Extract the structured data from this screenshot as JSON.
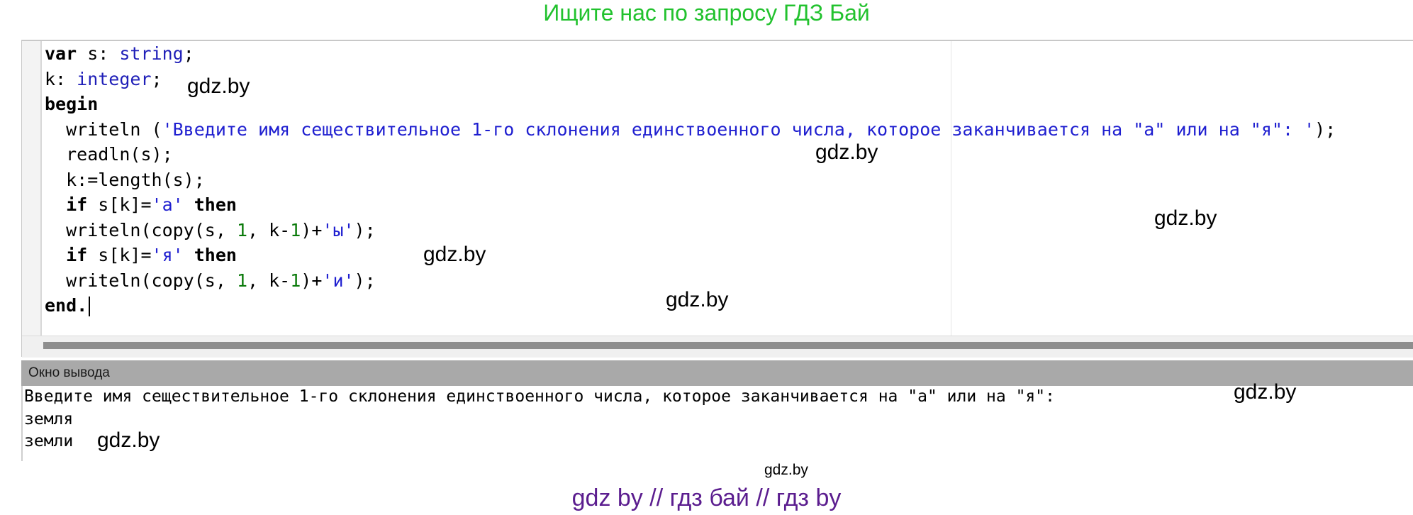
{
  "banner": {
    "top": "Ищите нас по запросу ГДЗ Бай",
    "bottom": "gdz by  //  гдз бай  //  гдз by"
  },
  "editor": {
    "lines": [
      [
        {
          "t": "var",
          "c": "kw"
        },
        {
          "t": " s: ",
          "c": ""
        },
        {
          "t": "string",
          "c": "ty"
        },
        {
          "t": ";",
          "c": ""
        }
      ],
      [
        {
          "t": "k: ",
          "c": ""
        },
        {
          "t": "integer",
          "c": "ty"
        },
        {
          "t": ";",
          "c": ""
        }
      ],
      [
        {
          "t": "begin",
          "c": "kw"
        }
      ],
      [
        {
          "t": "  writeln (",
          "c": ""
        },
        {
          "t": "'Введите имя сеществительное 1-го склонения единствоенного числа, которое заканчивается на \"а\" или на \"я\": '",
          "c": "str"
        },
        {
          "t": ");",
          "c": ""
        }
      ],
      [
        {
          "t": "  readln(s);",
          "c": ""
        }
      ],
      [
        {
          "t": "  k:=length(s);",
          "c": ""
        }
      ],
      [
        {
          "t": "  ",
          "c": ""
        },
        {
          "t": "if",
          "c": "kw"
        },
        {
          "t": " s[k]=",
          "c": ""
        },
        {
          "t": "'а'",
          "c": "str"
        },
        {
          "t": " ",
          "c": ""
        },
        {
          "t": "then",
          "c": "kw"
        }
      ],
      [
        {
          "t": "  writeln(copy(s, ",
          "c": ""
        },
        {
          "t": "1",
          "c": "num"
        },
        {
          "t": ", k-",
          "c": ""
        },
        {
          "t": "1",
          "c": "num"
        },
        {
          "t": ")+",
          "c": ""
        },
        {
          "t": "'ы'",
          "c": "str"
        },
        {
          "t": ");",
          "c": ""
        }
      ],
      [
        {
          "t": "  ",
          "c": ""
        },
        {
          "t": "if",
          "c": "kw"
        },
        {
          "t": " s[k]=",
          "c": ""
        },
        {
          "t": "'я'",
          "c": "str"
        },
        {
          "t": " ",
          "c": ""
        },
        {
          "t": "then",
          "c": "kw"
        }
      ],
      [
        {
          "t": "  writeln(copy(s, ",
          "c": ""
        },
        {
          "t": "1",
          "c": "num"
        },
        {
          "t": ", k-",
          "c": ""
        },
        {
          "t": "1",
          "c": "num"
        },
        {
          "t": ")+",
          "c": ""
        },
        {
          "t": "'и'",
          "c": "str"
        },
        {
          "t": ");",
          "c": ""
        }
      ],
      [
        {
          "t": "end.",
          "c": "kw"
        }
      ]
    ]
  },
  "output": {
    "title": "Окно вывода",
    "lines": [
      "Введите имя сеществительное 1-го склонения единствоенного числа, которое заканчивается на \"а\" или на \"я\":",
      "земля",
      "земли"
    ]
  },
  "watermarks": [
    "gdz.by",
    "gdz.by",
    "gdz.by",
    "gdz.by",
    "gdz.by",
    "gdz.by",
    "gdz.by",
    "gdz.by"
  ],
  "colors": {
    "top_banner": "#22c22e",
    "bottom_banner": "#5b1d8f",
    "string": "#1f1fd0",
    "type": "#1f1fb8",
    "number": "#0a7a0a"
  }
}
